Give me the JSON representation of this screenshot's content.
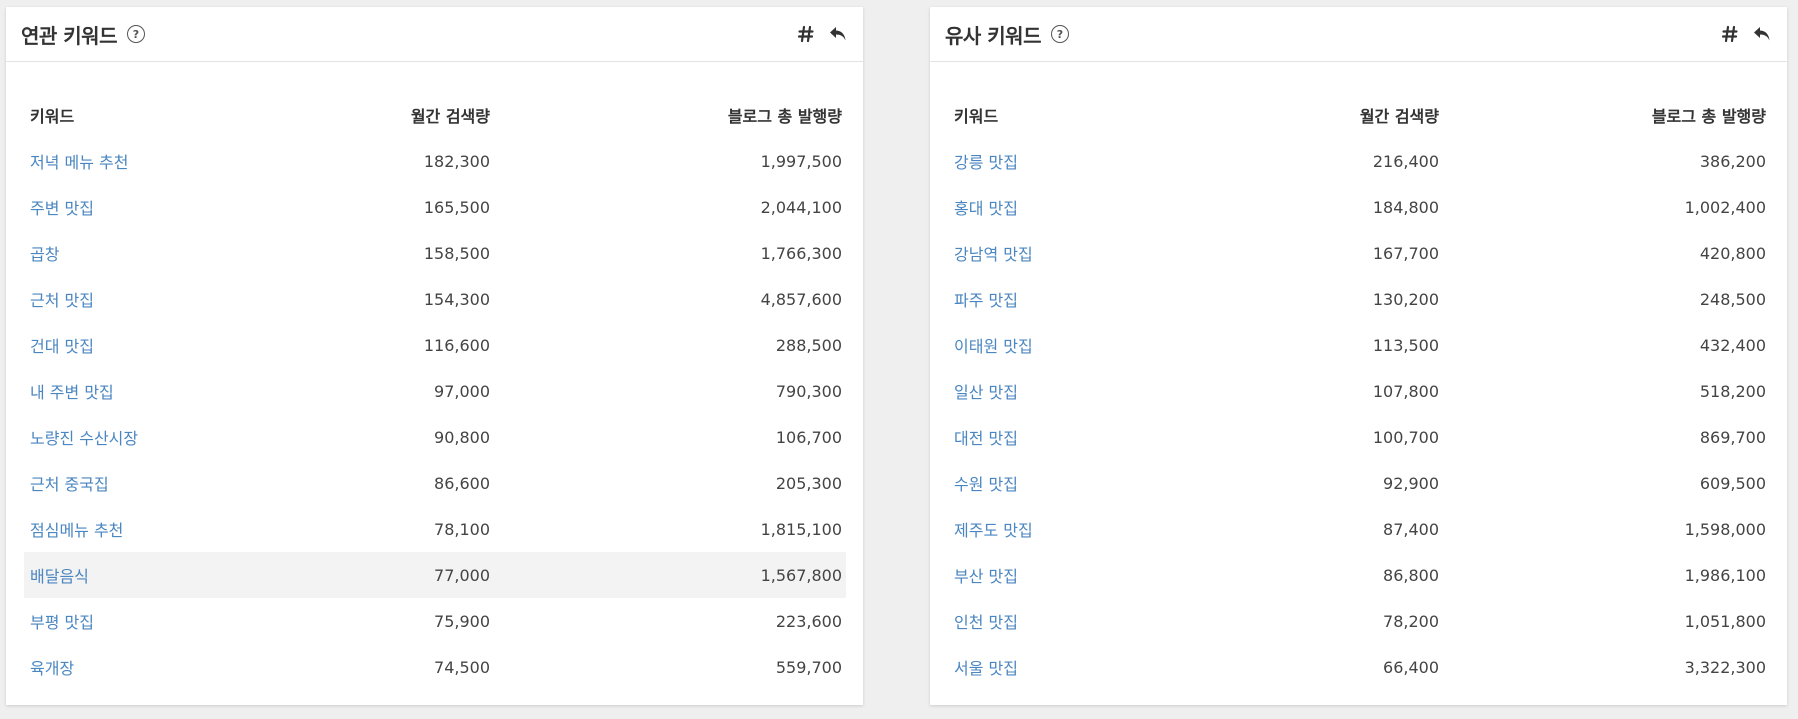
{
  "left_panel": {
    "title": "연관 키워드",
    "help_icon": "question-circle-icon",
    "actions": [
      "hash-icon",
      "reply-icon"
    ],
    "columns": [
      "키워드",
      "월간 검색량",
      "블로그 총 발행량"
    ],
    "rows": [
      {
        "keyword": "저녁 메뉴 추천",
        "monthly": "182,300",
        "blog": "1,997,500"
      },
      {
        "keyword": "주변 맛집",
        "monthly": "165,500",
        "blog": "2,044,100"
      },
      {
        "keyword": "곱창",
        "monthly": "158,500",
        "blog": "1,766,300"
      },
      {
        "keyword": "근처 맛집",
        "monthly": "154,300",
        "blog": "4,857,600"
      },
      {
        "keyword": "건대 맛집",
        "monthly": "116,600",
        "blog": "288,500"
      },
      {
        "keyword": "내 주변 맛집",
        "monthly": "97,000",
        "blog": "790,300"
      },
      {
        "keyword": "노량진 수산시장",
        "monthly": "90,800",
        "blog": "106,700"
      },
      {
        "keyword": "근처 중국집",
        "monthly": "86,600",
        "blog": "205,300"
      },
      {
        "keyword": "점심메뉴 추천",
        "monthly": "78,100",
        "blog": "1,815,100"
      },
      {
        "keyword": "배달음식",
        "monthly": "77,000",
        "blog": "1,567,800"
      },
      {
        "keyword": "부평 맛집",
        "monthly": "75,900",
        "blog": "223,600"
      },
      {
        "keyword": "육개장",
        "monthly": "74,500",
        "blog": "559,700"
      }
    ]
  },
  "right_panel": {
    "title": "유사 키워드",
    "help_icon": "question-circle-icon",
    "actions": [
      "hash-icon",
      "reply-icon"
    ],
    "columns": [
      "키워드",
      "월간 검색량",
      "블로그 총 발행량"
    ],
    "rows": [
      {
        "keyword": "강릉 맛집",
        "monthly": "216,400",
        "blog": "386,200"
      },
      {
        "keyword": "홍대 맛집",
        "monthly": "184,800",
        "blog": "1,002,400"
      },
      {
        "keyword": "강남역 맛집",
        "monthly": "167,700",
        "blog": "420,800"
      },
      {
        "keyword": "파주 맛집",
        "monthly": "130,200",
        "blog": "248,500"
      },
      {
        "keyword": "이태원 맛집",
        "monthly": "113,500",
        "blog": "432,400"
      },
      {
        "keyword": "일산 맛집",
        "monthly": "107,800",
        "blog": "518,200"
      },
      {
        "keyword": "대전 맛집",
        "monthly": "100,700",
        "blog": "869,700"
      },
      {
        "keyword": "수원 맛집",
        "monthly": "92,900",
        "blog": "609,500"
      },
      {
        "keyword": "제주도 맛집",
        "monthly": "87,400",
        "blog": "1,598,000"
      },
      {
        "keyword": "부산 맛집",
        "monthly": "86,800",
        "blog": "1,986,100"
      },
      {
        "keyword": "인천 맛집",
        "monthly": "78,200",
        "blog": "1,051,800"
      },
      {
        "keyword": "서울 맛집",
        "monthly": "66,400",
        "blog": "3,322,300"
      }
    ]
  },
  "colors": {
    "link": "#4a86c1",
    "highlight_row": "#f3f3f3",
    "background": "#efefef"
  }
}
